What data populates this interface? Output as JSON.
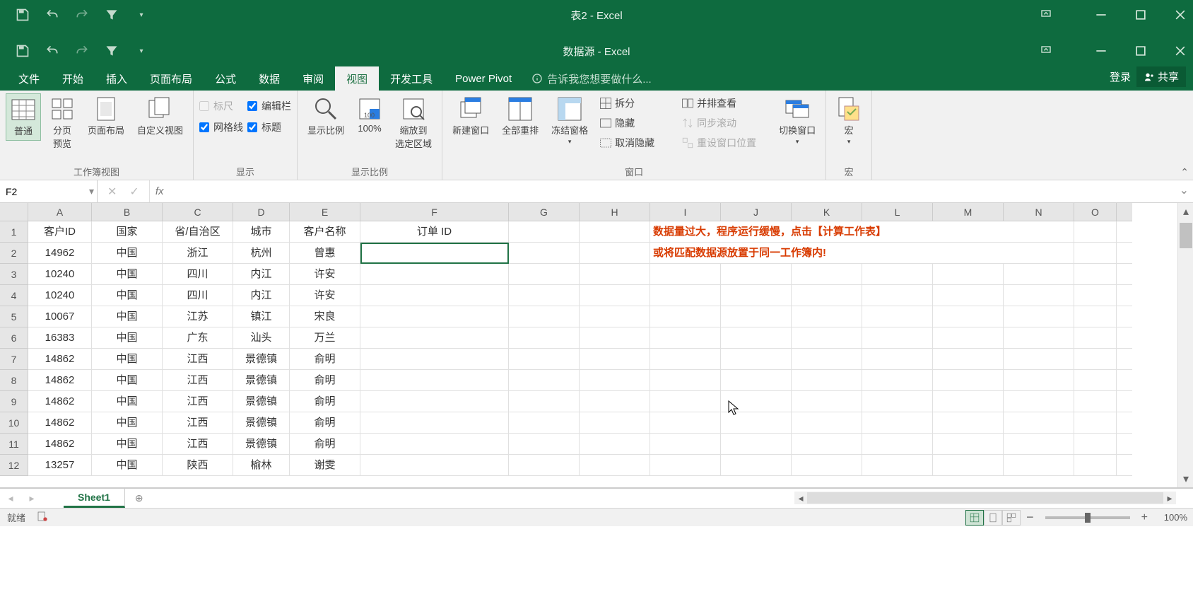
{
  "windows": {
    "back": {
      "title": "表2 - Excel"
    },
    "front": {
      "title": "数据源 - Excel"
    }
  },
  "tabs": {
    "file": "文件",
    "home": "开始",
    "insert": "插入",
    "page_layout": "页面布局",
    "formulas": "公式",
    "data": "数据",
    "review": "审阅",
    "view": "视图",
    "developer": "开发工具",
    "power_pivot": "Power Pivot",
    "tellme": "告诉我您想要做什么...",
    "login": "登录",
    "share": "共享"
  },
  "ribbon": {
    "groups": {
      "views": {
        "label": "工作簿视图",
        "normal": "普通",
        "page_break": "分页\n预览",
        "page_layout": "页面布局",
        "custom": "自定义视图"
      },
      "show": {
        "label": "显示",
        "ruler": "标尺",
        "formula_bar": "编辑栏",
        "gridlines": "网格线",
        "headings": "标题"
      },
      "zoom": {
        "label": "显示比例",
        "zoom": "显示比例",
        "p100": "100%",
        "to_selection": "缩放到\n选定区域"
      },
      "window": {
        "label": "窗口",
        "new_window": "新建窗口",
        "arrange_all": "全部重排",
        "freeze": "冻结窗格",
        "split": "拆分",
        "hide": "隐藏",
        "unhide": "取消隐藏",
        "side_by_side": "并排查看",
        "sync_scroll": "同步滚动",
        "reset_pos": "重设窗口位置",
        "switch": "切换窗口"
      },
      "macros": {
        "label": "宏",
        "macros": "宏"
      }
    }
  },
  "formula_bar": {
    "name_box": "F2",
    "value": ""
  },
  "columns": [
    "A",
    "B",
    "C",
    "D",
    "E",
    "F",
    "G",
    "H",
    "I",
    "J",
    "K",
    "L",
    "M",
    "N",
    "O"
  ],
  "row_numbers": [
    1,
    2,
    3,
    4,
    5,
    6,
    7,
    8,
    9,
    10,
    11,
    12
  ],
  "headers": {
    "A": "客户ID",
    "B": "国家",
    "C": "省/自治区",
    "D": "城市",
    "E": "客户名称",
    "F": "订单 ID"
  },
  "messages": {
    "line1": "数据量过大，程序运行缓慢，点击【计算工作表】",
    "line2": "或将匹配数据源放置于同一工作簿内!"
  },
  "rows": [
    {
      "A": "14962",
      "B": "中国",
      "C": "浙江",
      "D": "杭州",
      "E": "曾惠"
    },
    {
      "A": "10240",
      "B": "中国",
      "C": "四川",
      "D": "内江",
      "E": "许安"
    },
    {
      "A": "10240",
      "B": "中国",
      "C": "四川",
      "D": "内江",
      "E": "许安"
    },
    {
      "A": "10067",
      "B": "中国",
      "C": "江苏",
      "D": "镇江",
      "E": "宋良"
    },
    {
      "A": "16383",
      "B": "中国",
      "C": "广东",
      "D": "汕头",
      "E": "万兰"
    },
    {
      "A": "14862",
      "B": "中国",
      "C": "江西",
      "D": "景德镇",
      "E": "俞明"
    },
    {
      "A": "14862",
      "B": "中国",
      "C": "江西",
      "D": "景德镇",
      "E": "俞明"
    },
    {
      "A": "14862",
      "B": "中国",
      "C": "江西",
      "D": "景德镇",
      "E": "俞明"
    },
    {
      "A": "14862",
      "B": "中国",
      "C": "江西",
      "D": "景德镇",
      "E": "俞明"
    },
    {
      "A": "14862",
      "B": "中国",
      "C": "江西",
      "D": "景德镇",
      "E": "俞明"
    },
    {
      "A": "13257",
      "B": "中国",
      "C": "陕西",
      "D": "榆林",
      "E": "谢雯"
    }
  ],
  "sheet": {
    "name": "Sheet1"
  },
  "status": {
    "ready": "就绪",
    "zoom": "100%"
  }
}
